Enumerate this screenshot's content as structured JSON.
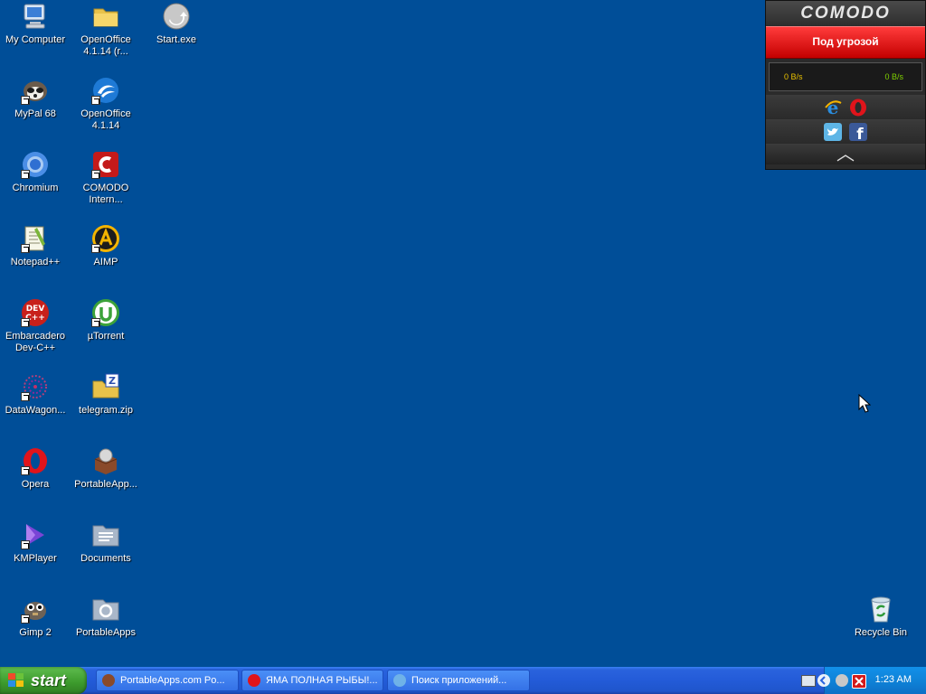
{
  "desktop": {
    "icons": [
      {
        "label": "My Computer"
      },
      {
        "label": "OpenOffice 4.1.14 (r..."
      },
      {
        "label": "Start.exe"
      },
      {
        "label": "MyPal 68"
      },
      {
        "label": "OpenOffice 4.1.14"
      },
      {
        "label": "Chromium"
      },
      {
        "label": "COMODO Intern..."
      },
      {
        "label": "Notepad++"
      },
      {
        "label": "AIMP"
      },
      {
        "label": "Embarcadero Dev-C++"
      },
      {
        "label": "µTorrent"
      },
      {
        "label": "DataWagon..."
      },
      {
        "label": "telegram.zip"
      },
      {
        "label": "Opera"
      },
      {
        "label": "PortableApp..."
      },
      {
        "label": "KMPlayer"
      },
      {
        "label": "Documents"
      },
      {
        "label": "Gimp 2"
      },
      {
        "label": "PortableApps"
      },
      {
        "label": "Recycle Bin"
      }
    ]
  },
  "comodo": {
    "brand": "COMODO",
    "status": "Под угрозой",
    "speed_in": "0 B/s",
    "speed_out": "0 B/s",
    "status_color": "#e00000"
  },
  "taskbar": {
    "start_label": "start",
    "tasks": [
      {
        "label": "PortableApps.com Po..."
      },
      {
        "label": "ЯМА ПОЛНАЯ РЫБЫ!..."
      },
      {
        "label": "Поиск приложений..."
      }
    ],
    "clock": "1:23 AM"
  }
}
